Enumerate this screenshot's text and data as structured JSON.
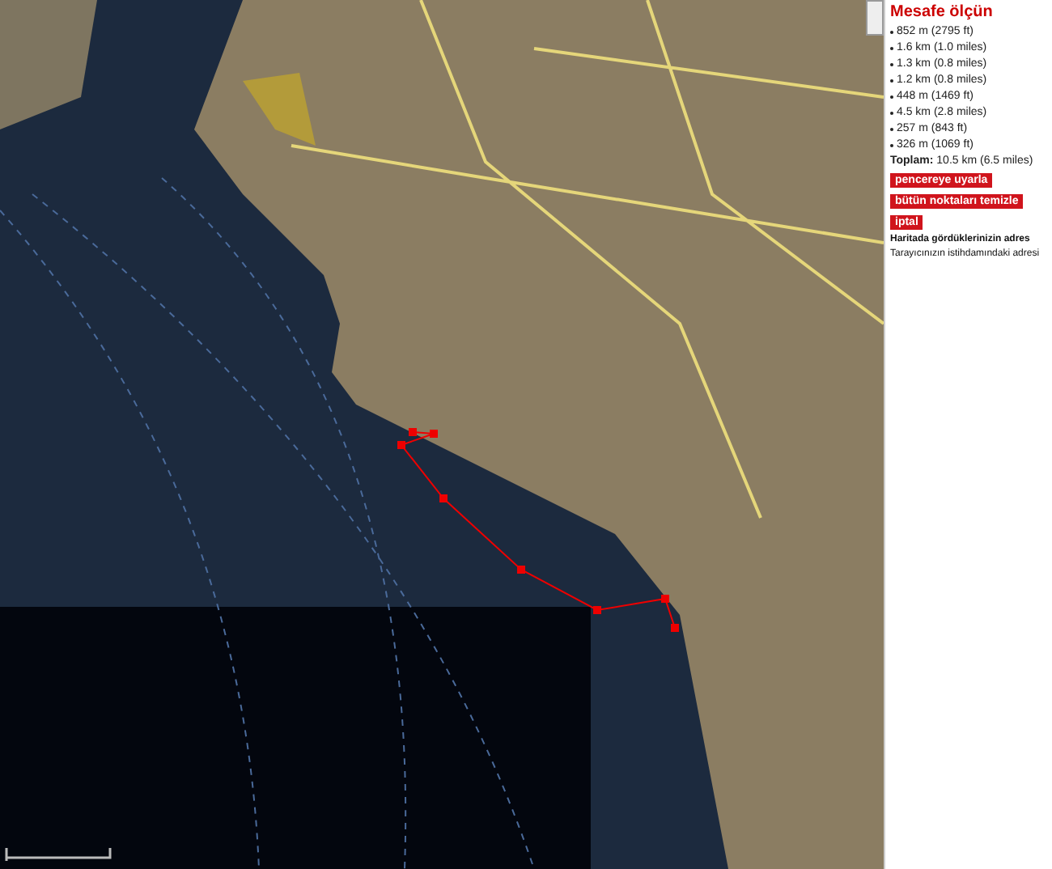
{
  "panel": {
    "title": "Mesafe ölçün",
    "segments": [
      "852 m (2795 ft)",
      "1.6 km (1.0 miles)",
      "1.3 km (0.8 miles)",
      "1.2 km (0.8 miles)",
      "448 m (1469 ft)",
      "4.5 km (2.8 miles)",
      "257 m (843 ft)",
      "326 m (1069 ft)"
    ],
    "total_label": "Toplam:",
    "total_value": "10.5 km (6.5 miles)",
    "buttons": [
      "pencereye uyarla",
      "bütün noktaları temizle",
      "iptal"
    ],
    "note_lines": [
      "Haritada gördüklerinizin adres",
      "Tarayıcınızın istihdamındaki adresi"
    ]
  }
}
